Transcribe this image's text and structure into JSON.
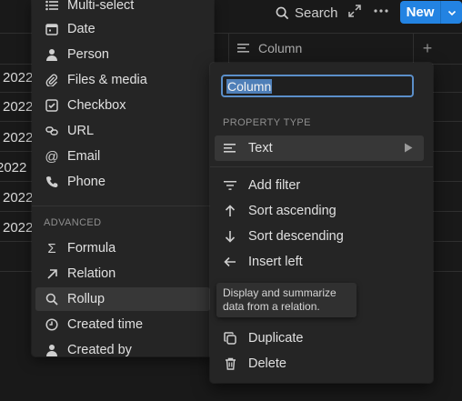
{
  "topbar": {
    "search_label": "Search",
    "new_label": "New"
  },
  "table": {
    "column_header": "Column",
    "row_values": [
      "2022",
      "2022",
      "2022",
      "2022",
      "2022",
      "2022"
    ]
  },
  "left_menu": {
    "items": [
      {
        "label": "Multi-select",
        "icon": "list-icon"
      },
      {
        "label": "Date",
        "icon": "calendar-icon"
      },
      {
        "label": "Person",
        "icon": "person-icon"
      },
      {
        "label": "Files & media",
        "icon": "paperclip-icon"
      },
      {
        "label": "Checkbox",
        "icon": "checkbox-icon"
      },
      {
        "label": "URL",
        "icon": "link-icon"
      },
      {
        "label": "Email",
        "icon": "at-icon"
      },
      {
        "label": "Phone",
        "icon": "phone-icon"
      }
    ],
    "advanced_title": "ADVANCED",
    "advanced_items": [
      {
        "label": "Formula",
        "icon": "sigma-icon"
      },
      {
        "label": "Relation",
        "icon": "arrow-up-right-icon"
      },
      {
        "label": "Rollup",
        "icon": "search-icon"
      },
      {
        "label": "Created time",
        "icon": "clock-icon"
      },
      {
        "label": "Created by",
        "icon": "person-icon"
      }
    ]
  },
  "property_menu": {
    "name_value": "Column",
    "property_type_title": "PROPERTY TYPE",
    "type_label": "Text",
    "actions": [
      {
        "label": "Add filter",
        "icon": "filter-icon"
      },
      {
        "label": "Sort ascending",
        "icon": "arrow-up-icon"
      },
      {
        "label": "Sort descending",
        "icon": "arrow-down-icon"
      },
      {
        "label": "Insert left",
        "icon": "arrow-left-icon"
      }
    ],
    "bottom_actions": [
      {
        "label": "Duplicate",
        "icon": "duplicate-icon"
      },
      {
        "label": "Delete",
        "icon": "trash-icon"
      }
    ]
  },
  "tooltip": {
    "line1": "Display and summarize",
    "line2": "data from a relation."
  },
  "colors": {
    "accent": "#2383e2",
    "background": "#191919",
    "menu": "#252525",
    "highlight": "#373737"
  }
}
